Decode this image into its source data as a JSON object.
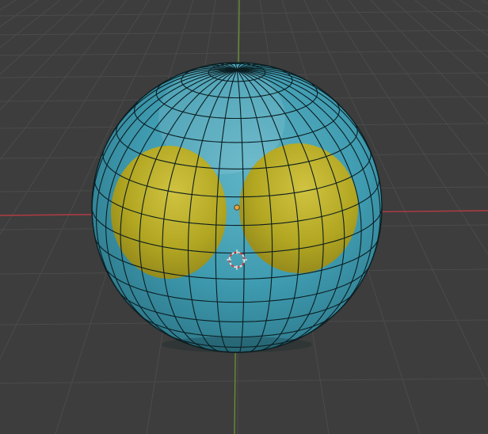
{
  "viewport": {
    "background": "#3d3d3d",
    "grid_color": "#4b4b4b",
    "x_axis_color": "#b23b44",
    "y_axis_color": "#6d9a2e"
  },
  "mesh": {
    "object": "uv-sphere",
    "fill_color": "#3f9bb0",
    "wire_color": "#0b1e22",
    "highlight_color": "#ffffff",
    "spots_color": "#c8b418"
  },
  "markers": {
    "origin_color": "#e8a43c",
    "cursor_primary": "#e8e8e8",
    "cursor_secondary": "#d04040"
  }
}
